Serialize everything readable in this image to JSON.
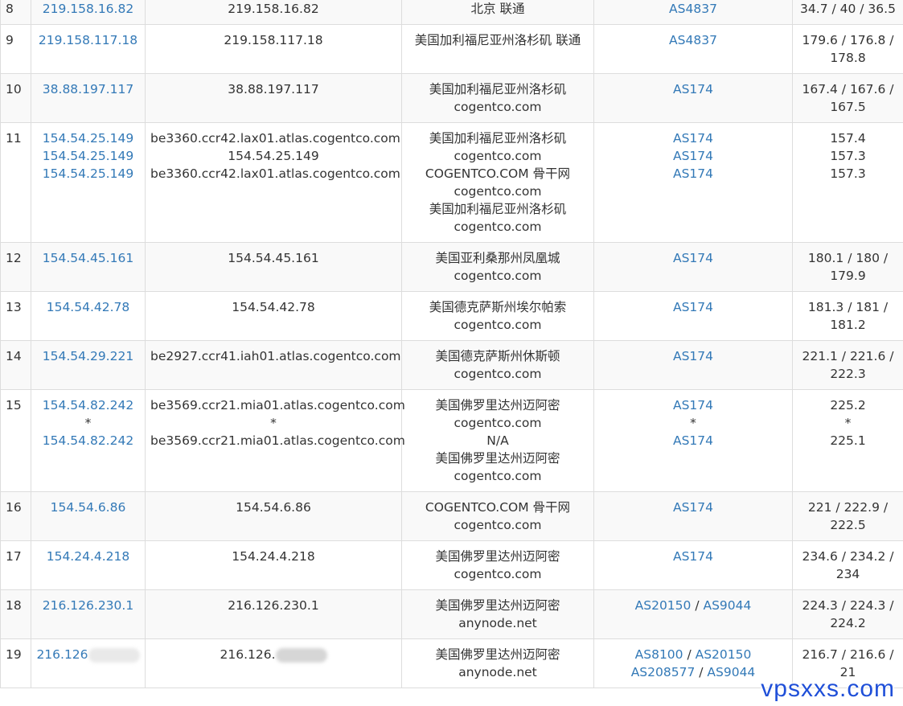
{
  "rows": [
    {
      "hop": "8",
      "ip": [
        "219.158.16.82"
      ],
      "host": [
        "219.158.16.82"
      ],
      "location": [
        "北京 联通"
      ],
      "asn": [
        [
          "AS4837"
        ]
      ],
      "latency": [
        "34.7 / 40 / 36.5"
      ]
    },
    {
      "hop": "9",
      "ip": [
        "219.158.117.18"
      ],
      "host": [
        "219.158.117.18"
      ],
      "location": [
        "美国加利福尼亚州洛杉矶 联通"
      ],
      "asn": [
        [
          "AS4837"
        ]
      ],
      "latency": [
        "179.6 / 176.8 /",
        "178.8"
      ]
    },
    {
      "hop": "10",
      "ip": [
        "38.88.197.117"
      ],
      "host": [
        "38.88.197.117"
      ],
      "location": [
        "美国加利福尼亚州洛杉矶",
        "cogentco.com"
      ],
      "asn": [
        [
          "AS174"
        ]
      ],
      "latency": [
        "167.4 / 167.6 /",
        "167.5"
      ]
    },
    {
      "hop": "11",
      "ip": [
        "154.54.25.149",
        "154.54.25.149",
        "154.54.25.149"
      ],
      "host": [
        "be3360.ccr42.lax01.atlas.cogentco.com",
        "154.54.25.149",
        "be3360.ccr42.lax01.atlas.cogentco.com"
      ],
      "location": [
        "美国加利福尼亚州洛杉矶",
        "cogentco.com",
        "COGENTCO.COM 骨干网",
        "cogentco.com",
        "美国加利福尼亚州洛杉矶",
        "cogentco.com"
      ],
      "asn": [
        [
          "AS174"
        ],
        [
          "AS174"
        ],
        [
          "AS174"
        ]
      ],
      "latency": [
        "157.4",
        "157.3",
        "157.3"
      ]
    },
    {
      "hop": "12",
      "ip": [
        "154.54.45.161"
      ],
      "host": [
        "154.54.45.161"
      ],
      "location": [
        "美国亚利桑那州凤凰城",
        "cogentco.com"
      ],
      "asn": [
        [
          "AS174"
        ]
      ],
      "latency": [
        "180.1 / 180 /",
        "179.9"
      ]
    },
    {
      "hop": "13",
      "ip": [
        "154.54.42.78"
      ],
      "host": [
        "154.54.42.78"
      ],
      "location": [
        "美国德克萨斯州埃尔帕索",
        "cogentco.com"
      ],
      "asn": [
        [
          "AS174"
        ]
      ],
      "latency": [
        "181.3 / 181 /",
        "181.2"
      ]
    },
    {
      "hop": "14",
      "ip": [
        "154.54.29.221"
      ],
      "host": [
        "be2927.ccr41.iah01.atlas.cogentco.com"
      ],
      "location": [
        "美国德克萨斯州休斯顿",
        "cogentco.com"
      ],
      "asn": [
        [
          "AS174"
        ]
      ],
      "latency": [
        "221.1 / 221.6 /",
        "222.3"
      ]
    },
    {
      "hop": "15",
      "ip": [
        "154.54.82.242",
        "*",
        "154.54.82.242"
      ],
      "host": [
        "be3569.ccr21.mia01.atlas.cogentco.com",
        "*",
        "be3569.ccr21.mia01.atlas.cogentco.com"
      ],
      "location": [
        "美国佛罗里达州迈阿密",
        "cogentco.com",
        "N/A",
        "美国佛罗里达州迈阿密",
        "cogentco.com"
      ],
      "asn": [
        [
          "AS174"
        ],
        [
          "*"
        ],
        [
          "AS174"
        ]
      ],
      "latency": [
        "225.2",
        "*",
        "225.1"
      ]
    },
    {
      "hop": "16",
      "ip": [
        "154.54.6.86"
      ],
      "host": [
        "154.54.6.86"
      ],
      "location": [
        "COGENTCO.COM 骨干网",
        "cogentco.com"
      ],
      "asn": [
        [
          "AS174"
        ]
      ],
      "latency": [
        "221 / 222.9 /",
        "222.5"
      ]
    },
    {
      "hop": "17",
      "ip": [
        "154.24.4.218"
      ],
      "host": [
        "154.24.4.218"
      ],
      "location": [
        "美国佛罗里达州迈阿密",
        "cogentco.com"
      ],
      "asn": [
        [
          "AS174"
        ]
      ],
      "latency": [
        "234.6 / 234.2 /",
        "234"
      ]
    },
    {
      "hop": "18",
      "ip": [
        "216.126.230.1"
      ],
      "host": [
        "216.126.230.1"
      ],
      "location": [
        "美国佛罗里达州迈阿密",
        "anynode.net"
      ],
      "asn": [
        [
          "AS20150",
          "AS9044"
        ]
      ],
      "latency": [
        "224.3 / 224.3 /",
        "224.2"
      ]
    },
    {
      "hop": "19",
      "ip": [
        "216.126"
      ],
      "host": [
        "216.126."
      ],
      "location": [
        "美国佛罗里达州迈阿密",
        "anynode.net"
      ],
      "asn": [
        [
          "AS8100",
          "AS20150"
        ],
        [
          "AS208577",
          "AS9044"
        ]
      ],
      "latency": [
        "216.7 / 216.6 /",
        "21"
      ],
      "redacted": true
    }
  ],
  "colors": {
    "link": "#3379b7",
    "text": "#333333",
    "border": "#dddddd",
    "stripe": "#f9f9f9",
    "watermark": "#1f4fd8"
  },
  "watermark": "vpsxxs.com",
  "separator": " / "
}
